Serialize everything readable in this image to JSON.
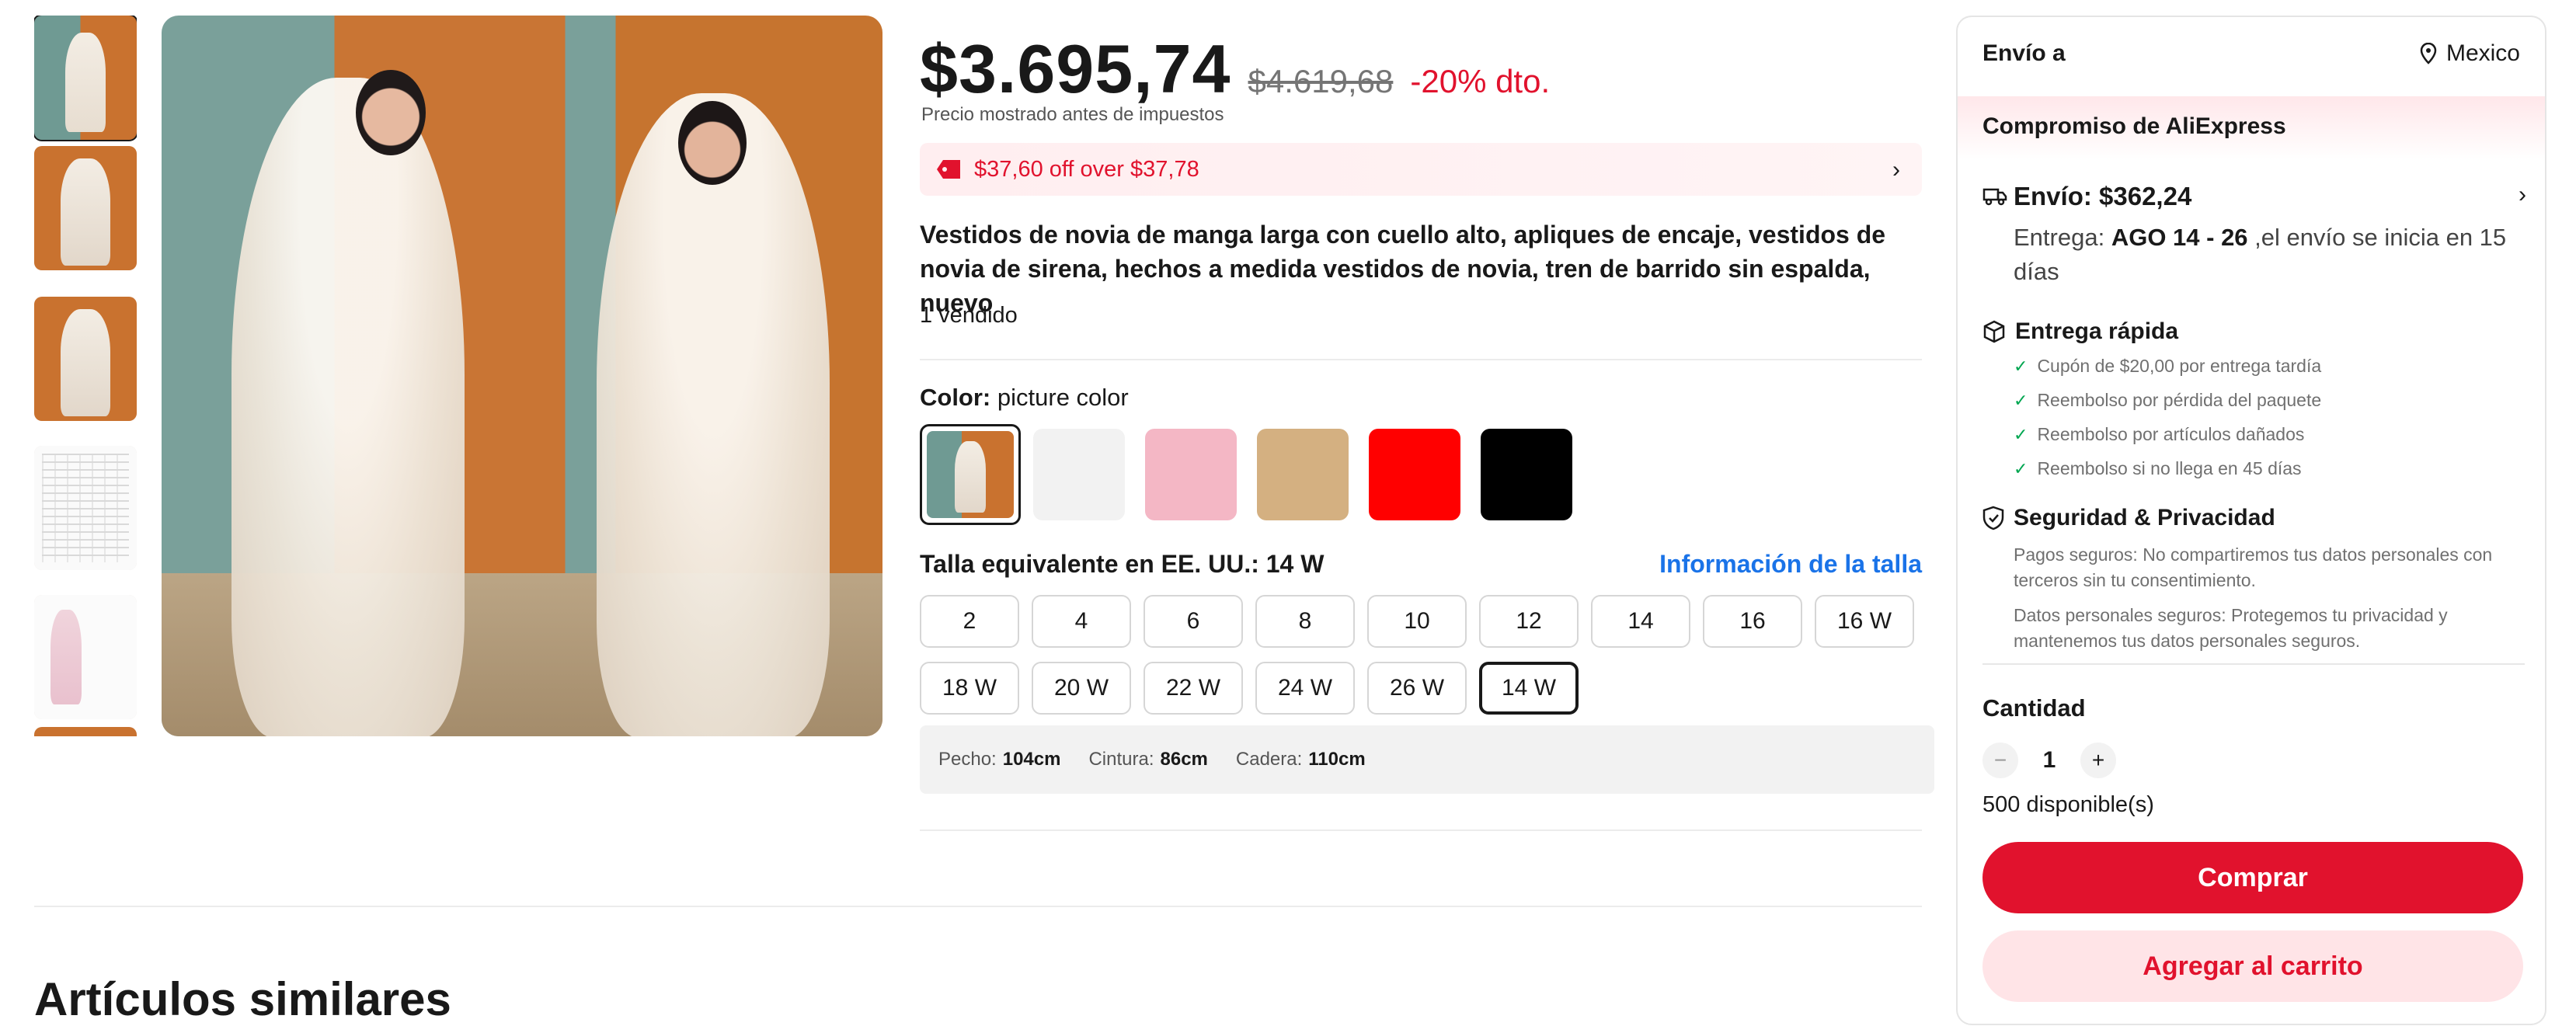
{
  "price": {
    "current": "$3.695,74",
    "original": "$4.619,68",
    "discount": "-20% dto.",
    "tax_note": "Precio mostrado antes de impuestos"
  },
  "coupon": {
    "text": "$37,60 off over $37,78"
  },
  "product": {
    "title": "Vestidos de novia de manga larga con cuello alto, apliques de encaje, vestidos de novia de sirena, hechos a medida vestidos de novia, tren de barrido sin espalda, nuevo",
    "sold": "1 vendido"
  },
  "color": {
    "label": "Color:",
    "selected": "picture color",
    "swatches": [
      "#f2f2f2",
      "#f4b7c5",
      "#d4b081",
      "#ff0000",
      "#000000"
    ]
  },
  "size": {
    "label": "Talla equivalente en EE. UU.: 14 W",
    "info_link": "Información de la talla",
    "options": [
      "2",
      "4",
      "6",
      "8",
      "10",
      "12",
      "14",
      "16",
      "16 W",
      "18 W",
      "20 W",
      "22 W",
      "24 W",
      "26 W",
      "14 W"
    ],
    "selected": "14 W"
  },
  "measurements": {
    "chest_label": "Pecho:",
    "chest_value": "104cm",
    "waist_label": "Cintura:",
    "waist_value": "86cm",
    "hip_label": "Cadera:",
    "hip_value": "110cm"
  },
  "related": {
    "heading": "Artículos similares"
  },
  "panel": {
    "ship_to": "Envío a",
    "country": "Mexico",
    "commitment": "Compromiso de AliExpress",
    "shipping_cost": "Envío: $362,24",
    "delivery_prefix": "Entrega: ",
    "delivery_dates": "AGO 14 - 26",
    "delivery_suffix": " ,el envío se inicia en 15 días",
    "fast_delivery": "Entrega rápida",
    "guarantees": [
      "Cupón de $20,00 por entrega tardía",
      "Reembolso por pérdida del paquete",
      "Reembolso por artículos dañados",
      "Reembolso si no llega en 45 días"
    ],
    "security_title": "Seguridad & Privacidad",
    "security_line1": "Pagos seguros: No compartiremos tus datos personales con terceros sin tu consentimiento.",
    "security_line2": "Datos personales seguros: Protegemos tu privacidad y mantenemos tus datos personales seguros.",
    "quantity_label": "Cantidad",
    "quantity": "1",
    "available": "500 disponible(s)",
    "buy": "Comprar",
    "add_to_cart": "Agregar al carrito"
  },
  "colors": {
    "accent": "#e1122d",
    "link": "#1a73e8"
  }
}
